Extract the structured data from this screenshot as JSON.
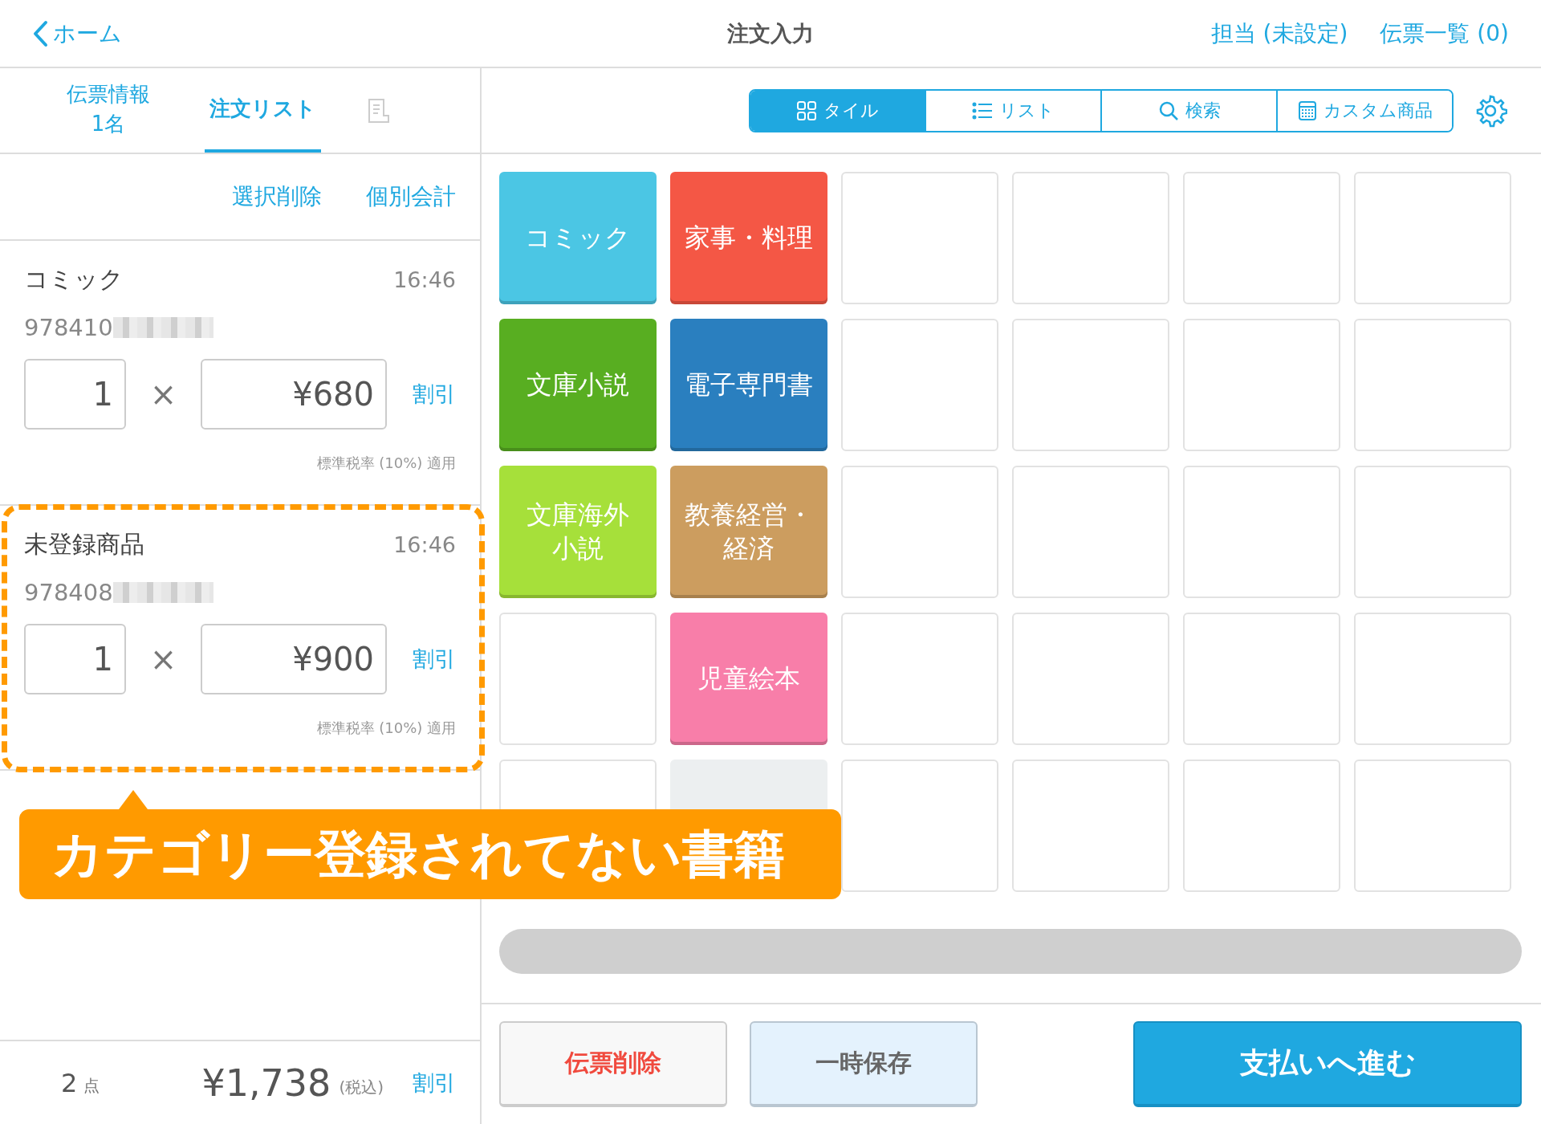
{
  "header": {
    "back": "ホーム",
    "title": "注文入力",
    "links": [
      "担当 (未設定)",
      "伝票一覧 (0)"
    ]
  },
  "left_tabs": [
    {
      "label": "伝票情報",
      "sub": "1名",
      "selected": false
    },
    {
      "label": "注文リスト",
      "selected": true
    }
  ],
  "actions": [
    "選択削除",
    "個別会計"
  ],
  "items": [
    {
      "name": "コミック",
      "time": "16:46",
      "code": "978410",
      "qty": "1",
      "times": "×",
      "price": "¥680",
      "discount": "割引",
      "tax": "標準税率 (10%) 適用",
      "highlighted": false
    },
    {
      "name": "未登録商品",
      "time": "16:46",
      "code": "978408",
      "qty": "1",
      "times": "×",
      "price": "¥900",
      "discount": "割引",
      "tax": "標準税率 (10%) 適用",
      "highlighted": true
    }
  ],
  "total": {
    "count": "2",
    "count_unit": "点",
    "amount": "¥1,738",
    "tax_note": "(税込)",
    "discount": "割引"
  },
  "annotation": {
    "text": "カテゴリー登録されてない書籍"
  },
  "views": [
    {
      "kind": "tile",
      "label": "タイル",
      "selected": true
    },
    {
      "kind": "list",
      "label": "リスト",
      "selected": false
    },
    {
      "kind": "search",
      "label": "検索",
      "selected": false
    },
    {
      "kind": "custom",
      "label": "カスタム商品",
      "selected": false
    }
  ],
  "tiles": [
    {
      "kind": "category",
      "label": "コミック",
      "color": "#4bc6e4"
    },
    {
      "kind": "category",
      "label": "家事・料理",
      "color": "#f45745"
    },
    {
      "kind": "empty"
    },
    {
      "kind": "empty"
    },
    {
      "kind": "empty"
    },
    {
      "kind": "empty"
    },
    {
      "kind": "category",
      "label": "文庫小説",
      "color": "#58ae21"
    },
    {
      "kind": "category",
      "label": "電子専門書",
      "color": "#2a7fbf"
    },
    {
      "kind": "empty"
    },
    {
      "kind": "empty"
    },
    {
      "kind": "empty"
    },
    {
      "kind": "empty"
    },
    {
      "kind": "category",
      "lines": [
        "文庫海外",
        "小説"
      ],
      "color": "#a6e03a"
    },
    {
      "kind": "category",
      "lines": [
        "教養経営・",
        "経済"
      ],
      "color": "#cc9d5f"
    },
    {
      "kind": "empty"
    },
    {
      "kind": "empty"
    },
    {
      "kind": "empty"
    },
    {
      "kind": "empty"
    },
    {
      "kind": "empty"
    },
    {
      "kind": "category",
      "label": "児童絵本",
      "color": "#f87ea9"
    },
    {
      "kind": "empty"
    },
    {
      "kind": "empty"
    },
    {
      "kind": "empty"
    },
    {
      "kind": "empty"
    },
    {
      "kind": "empty"
    },
    {
      "kind": "blank"
    },
    {
      "kind": "empty"
    },
    {
      "kind": "empty"
    },
    {
      "kind": "empty"
    },
    {
      "kind": "empty"
    }
  ],
  "buttons": [
    {
      "kind": "danger",
      "label": "伝票削除"
    },
    {
      "kind": "secondary",
      "label": "一時保存"
    },
    {
      "kind": "primary",
      "label": "支払いへ進む"
    }
  ]
}
